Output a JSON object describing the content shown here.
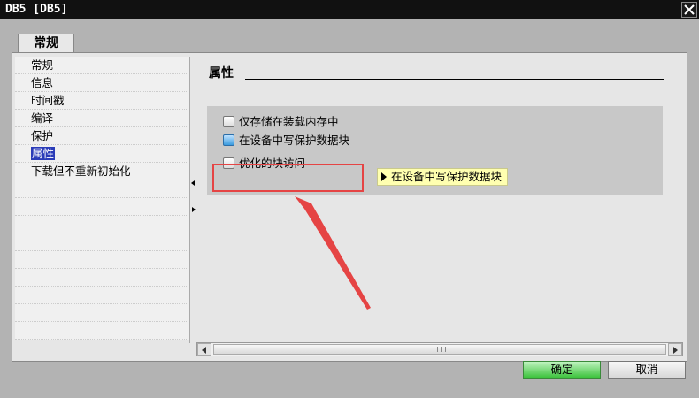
{
  "window": {
    "title": "DB5 [DB5]"
  },
  "tabs": [
    {
      "label": "常规"
    }
  ],
  "sidebar": {
    "items": [
      {
        "label": "常规"
      },
      {
        "label": "信息"
      },
      {
        "label": "时间戳"
      },
      {
        "label": "编译"
      },
      {
        "label": "保护"
      },
      {
        "label": "属性",
        "selected": true
      },
      {
        "label": "下载但不重新初始化"
      }
    ]
  },
  "content": {
    "section_title": "属性",
    "options": [
      {
        "label": "仅存储在装载内存中",
        "checked": false
      },
      {
        "label": "在设备中写保护数据块",
        "checked": false,
        "focused": true
      },
      {
        "label": "优化的块访问",
        "checked": false
      }
    ],
    "tooltip": "在设备中写保护数据块"
  },
  "footer": {
    "ok_label": "确定",
    "cancel_label": "取消"
  },
  "colors": {
    "annotation": "#e54444",
    "ok_button": "#3dc33d",
    "selection": "#2a3bb8"
  }
}
